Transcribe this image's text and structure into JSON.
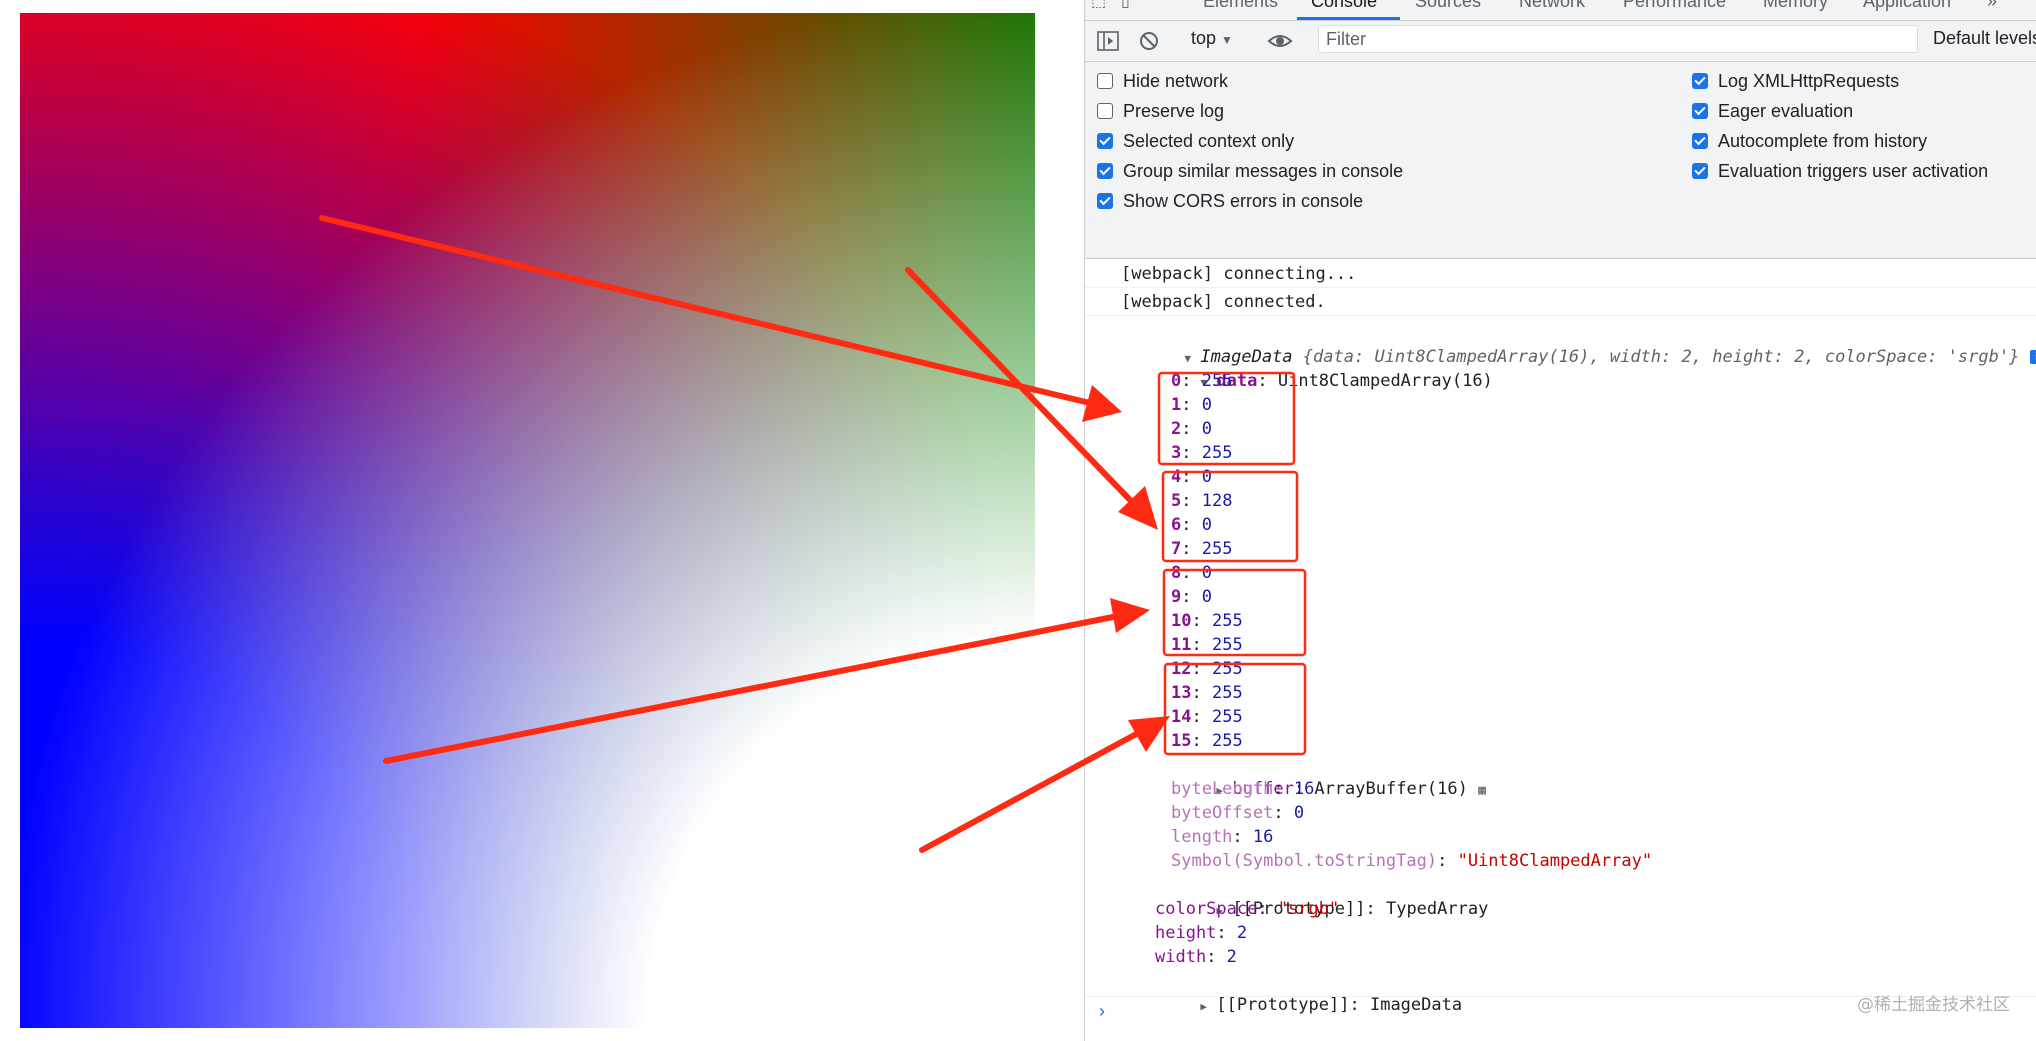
{
  "devtools": {
    "tabs": [
      "Elements",
      "Console",
      "Sources",
      "Network",
      "Performance",
      "Memory",
      "Application"
    ],
    "active_tab": "Console",
    "more_tabs_icon": "chevron-double-right-icon",
    "toolbar": {
      "context": "top",
      "filter_placeholder": "Filter",
      "levels": "Default levels"
    },
    "settings": {
      "left": [
        {
          "label": "Hide network",
          "checked": false
        },
        {
          "label": "Preserve log",
          "checked": false
        },
        {
          "label": "Selected context only",
          "checked": true
        },
        {
          "label": "Group similar messages in console",
          "checked": true
        },
        {
          "label": "Show CORS errors in console",
          "checked": true
        }
      ],
      "right": [
        {
          "label": "Log XMLHttpRequests",
          "checked": true
        },
        {
          "label": "Eager evaluation",
          "checked": true
        },
        {
          "label": "Autocomplete from history",
          "checked": true
        },
        {
          "label": "Evaluation triggers user activation",
          "checked": true
        }
      ]
    },
    "console": {
      "messages": [
        "[webpack] connecting...",
        "[webpack] connected."
      ],
      "object_name": "ImageData",
      "object_preview": {
        "data": "Uint8ClampedArray(16)",
        "width": "2",
        "height": "2",
        "colorSpace": "'srgb'"
      },
      "data_label": "data",
      "data_type": "Uint8ClampedArray(16)",
      "entries": [
        {
          "key": "0",
          "value": "255"
        },
        {
          "key": "1",
          "value": "0"
        },
        {
          "key": "2",
          "value": "0"
        },
        {
          "key": "3",
          "value": "255"
        },
        {
          "key": "4",
          "value": "0"
        },
        {
          "key": "5",
          "value": "128"
        },
        {
          "key": "6",
          "value": "0"
        },
        {
          "key": "7",
          "value": "255"
        },
        {
          "key": "8",
          "value": "0"
        },
        {
          "key": "9",
          "value": "0"
        },
        {
          "key": "10",
          "value": "255"
        },
        {
          "key": "11",
          "value": "255"
        },
        {
          "key": "12",
          "value": "255"
        },
        {
          "key": "13",
          "value": "255"
        },
        {
          "key": "14",
          "value": "255"
        },
        {
          "key": "15",
          "value": "255"
        }
      ],
      "buffer": {
        "key": "buffer",
        "value": "ArrayBuffer(16)"
      },
      "byteLength": {
        "key": "byteLength",
        "value": "16"
      },
      "byteOffset": {
        "key": "byteOffset",
        "value": "0"
      },
      "length": {
        "key": "length",
        "value": "16"
      },
      "tostringtag": {
        "key": "Symbol(Symbol.toStringTag)",
        "value": "\"Uint8ClampedArray\""
      },
      "typed_proto": {
        "key": "[[Prototype]]",
        "value": "TypedArray"
      },
      "colorSpace": {
        "key": "colorSpace",
        "value": "\"srgb\""
      },
      "height": {
        "key": "height",
        "value": "2"
      },
      "width": {
        "key": "width",
        "value": "2"
      },
      "imagedata_proto": {
        "key": "[[Prototype]]",
        "value": "ImageData"
      },
      "prompt": "›"
    }
  },
  "canvas": {
    "corner_colors": {
      "top_left": "#ff0000",
      "top_right": "#008000",
      "bottom_left": "#0000ff",
      "bottom_right": "#ffffff"
    }
  },
  "annotation_color": "#ff2a12",
  "watermark": "@稀土掘金技术社区"
}
